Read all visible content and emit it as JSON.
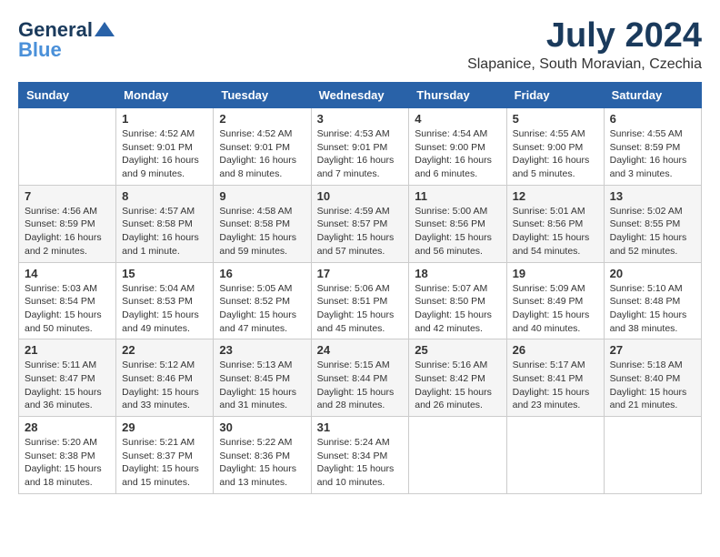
{
  "header": {
    "logo_general": "General",
    "logo_blue": "Blue",
    "month": "July 2024",
    "location": "Slapanice, South Moravian, Czechia"
  },
  "weekdays": [
    "Sunday",
    "Monday",
    "Tuesday",
    "Wednesday",
    "Thursday",
    "Friday",
    "Saturday"
  ],
  "weeks": [
    [
      {
        "day": "",
        "info": ""
      },
      {
        "day": "1",
        "info": "Sunrise: 4:52 AM\nSunset: 9:01 PM\nDaylight: 16 hours\nand 9 minutes."
      },
      {
        "day": "2",
        "info": "Sunrise: 4:52 AM\nSunset: 9:01 PM\nDaylight: 16 hours\nand 8 minutes."
      },
      {
        "day": "3",
        "info": "Sunrise: 4:53 AM\nSunset: 9:01 PM\nDaylight: 16 hours\nand 7 minutes."
      },
      {
        "day": "4",
        "info": "Sunrise: 4:54 AM\nSunset: 9:00 PM\nDaylight: 16 hours\nand 6 minutes."
      },
      {
        "day": "5",
        "info": "Sunrise: 4:55 AM\nSunset: 9:00 PM\nDaylight: 16 hours\nand 5 minutes."
      },
      {
        "day": "6",
        "info": "Sunrise: 4:55 AM\nSunset: 8:59 PM\nDaylight: 16 hours\nand 3 minutes."
      }
    ],
    [
      {
        "day": "7",
        "info": "Sunrise: 4:56 AM\nSunset: 8:59 PM\nDaylight: 16 hours\nand 2 minutes."
      },
      {
        "day": "8",
        "info": "Sunrise: 4:57 AM\nSunset: 8:58 PM\nDaylight: 16 hours\nand 1 minute."
      },
      {
        "day": "9",
        "info": "Sunrise: 4:58 AM\nSunset: 8:58 PM\nDaylight: 15 hours\nand 59 minutes."
      },
      {
        "day": "10",
        "info": "Sunrise: 4:59 AM\nSunset: 8:57 PM\nDaylight: 15 hours\nand 57 minutes."
      },
      {
        "day": "11",
        "info": "Sunrise: 5:00 AM\nSunset: 8:56 PM\nDaylight: 15 hours\nand 56 minutes."
      },
      {
        "day": "12",
        "info": "Sunrise: 5:01 AM\nSunset: 8:56 PM\nDaylight: 15 hours\nand 54 minutes."
      },
      {
        "day": "13",
        "info": "Sunrise: 5:02 AM\nSunset: 8:55 PM\nDaylight: 15 hours\nand 52 minutes."
      }
    ],
    [
      {
        "day": "14",
        "info": "Sunrise: 5:03 AM\nSunset: 8:54 PM\nDaylight: 15 hours\nand 50 minutes."
      },
      {
        "day": "15",
        "info": "Sunrise: 5:04 AM\nSunset: 8:53 PM\nDaylight: 15 hours\nand 49 minutes."
      },
      {
        "day": "16",
        "info": "Sunrise: 5:05 AM\nSunset: 8:52 PM\nDaylight: 15 hours\nand 47 minutes."
      },
      {
        "day": "17",
        "info": "Sunrise: 5:06 AM\nSunset: 8:51 PM\nDaylight: 15 hours\nand 45 minutes."
      },
      {
        "day": "18",
        "info": "Sunrise: 5:07 AM\nSunset: 8:50 PM\nDaylight: 15 hours\nand 42 minutes."
      },
      {
        "day": "19",
        "info": "Sunrise: 5:09 AM\nSunset: 8:49 PM\nDaylight: 15 hours\nand 40 minutes."
      },
      {
        "day": "20",
        "info": "Sunrise: 5:10 AM\nSunset: 8:48 PM\nDaylight: 15 hours\nand 38 minutes."
      }
    ],
    [
      {
        "day": "21",
        "info": "Sunrise: 5:11 AM\nSunset: 8:47 PM\nDaylight: 15 hours\nand 36 minutes."
      },
      {
        "day": "22",
        "info": "Sunrise: 5:12 AM\nSunset: 8:46 PM\nDaylight: 15 hours\nand 33 minutes."
      },
      {
        "day": "23",
        "info": "Sunrise: 5:13 AM\nSunset: 8:45 PM\nDaylight: 15 hours\nand 31 minutes."
      },
      {
        "day": "24",
        "info": "Sunrise: 5:15 AM\nSunset: 8:44 PM\nDaylight: 15 hours\nand 28 minutes."
      },
      {
        "day": "25",
        "info": "Sunrise: 5:16 AM\nSunset: 8:42 PM\nDaylight: 15 hours\nand 26 minutes."
      },
      {
        "day": "26",
        "info": "Sunrise: 5:17 AM\nSunset: 8:41 PM\nDaylight: 15 hours\nand 23 minutes."
      },
      {
        "day": "27",
        "info": "Sunrise: 5:18 AM\nSunset: 8:40 PM\nDaylight: 15 hours\nand 21 minutes."
      }
    ],
    [
      {
        "day": "28",
        "info": "Sunrise: 5:20 AM\nSunset: 8:38 PM\nDaylight: 15 hours\nand 18 minutes."
      },
      {
        "day": "29",
        "info": "Sunrise: 5:21 AM\nSunset: 8:37 PM\nDaylight: 15 hours\nand 15 minutes."
      },
      {
        "day": "30",
        "info": "Sunrise: 5:22 AM\nSunset: 8:36 PM\nDaylight: 15 hours\nand 13 minutes."
      },
      {
        "day": "31",
        "info": "Sunrise: 5:24 AM\nSunset: 8:34 PM\nDaylight: 15 hours\nand 10 minutes."
      },
      {
        "day": "",
        "info": ""
      },
      {
        "day": "",
        "info": ""
      },
      {
        "day": "",
        "info": ""
      }
    ]
  ]
}
